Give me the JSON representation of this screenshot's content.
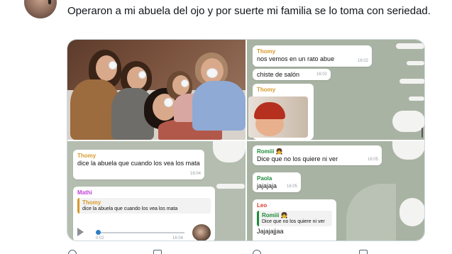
{
  "tweet": {
    "text": "Operaron a mi abuela del ojo y por suerte mi familia se lo toma con seriedad."
  },
  "chat_top_right": {
    "msg1_sender": "Thomy",
    "msg1_text": "nos vemos en un rato abue",
    "msg1_time": "16:02",
    "msg2_text": "chiste de salón",
    "msg2_time": "16:02",
    "msg3_sender": "Thomy"
  },
  "chat_bottom_left": {
    "msg1_sender": "Thomy",
    "msg1_text": "dice la abuela que cuando los vea los mata",
    "msg1_time": "16:04",
    "msg2_sender": "Mathi",
    "msg2_quote_sender": "Thomy",
    "msg2_quote_text": "dice la abuela que cuando los vea los mata",
    "audio_elapsed": "0:02",
    "audio_time": "16:04"
  },
  "chat_bottom_right": {
    "msg1_sender": "Romiii 👧",
    "msg1_text": "Dice que no los quiere ni ver",
    "msg1_time": "16:05",
    "msg2_sender": "Paola",
    "msg2_text": "jajajaja",
    "msg2_time": "16:05",
    "msg3_sender": "Leo",
    "msg3_quote_sender": "Romiii 👧",
    "msg3_quote_text": "Dice que no los quiere ni ver",
    "msg3_text": "Jajajajjaa"
  },
  "colors": {
    "thomy": "#d89a2b",
    "mathi": "#c13fd8",
    "romiii": "#1f8a3a",
    "paola": "#1f8a3a",
    "leo": "#d83a2a",
    "chat_bg": "#a9b3a3"
  }
}
